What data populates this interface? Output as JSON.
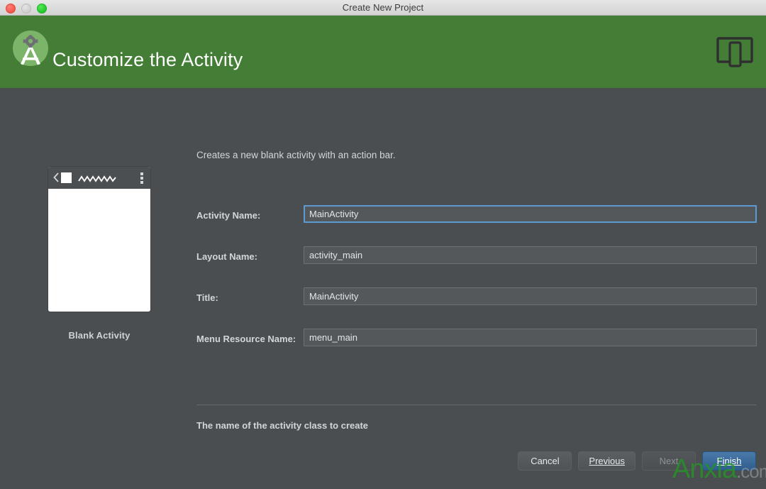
{
  "window": {
    "title": "Create New Project",
    "controls": [
      "close-button",
      "minimize-button",
      "zoom-button"
    ]
  },
  "header": {
    "title": "Customize the Activity",
    "logo_icon": "android-studio-logo-icon",
    "device_icon": "tablet-phone-device-icon",
    "background_color": "#437d36"
  },
  "preview": {
    "caption": "Blank Activity",
    "phone_bar": {
      "back_icon": "back-chevron-icon",
      "app_icon": "app-square-icon",
      "title_placeholder_icon": "zigzag-title-icon",
      "overflow_icon": "overflow-menu-icon"
    }
  },
  "main": {
    "description": "Creates a new blank activity with an action bar.",
    "fields": [
      {
        "label": "Activity Name:",
        "value": "MainActivity",
        "name": "activity-name",
        "focused": true
      },
      {
        "label": "Layout Name:",
        "value": "activity_main",
        "name": "layout-name",
        "focused": false
      },
      {
        "label": "Title:",
        "value": "MainActivity",
        "name": "title",
        "focused": false
      },
      {
        "label": "Menu Resource Name:",
        "value": "menu_main",
        "name": "menu-resource-name",
        "focused": false
      }
    ],
    "hint": "The name of the activity class to create"
  },
  "footer": {
    "buttons": [
      {
        "label": "Cancel",
        "name": "cancel-button",
        "state": "enabled",
        "mnemonic": ""
      },
      {
        "label": "Previous",
        "name": "previous-button",
        "state": "enabled",
        "mnemonic": "P"
      },
      {
        "label": "Next",
        "name": "next-button",
        "state": "disabled",
        "mnemonic": ""
      },
      {
        "label": "Finish",
        "name": "finish-button",
        "state": "default",
        "mnemonic": "F"
      }
    ]
  },
  "watermark": {
    "primary": "Anxia",
    "secondary": ".com"
  },
  "colors": {
    "header_green": "#437d36",
    "panel_gray": "#4b4e51",
    "field_bg": "#55585b",
    "focus_blue": "#5b9bd0",
    "default_button_blue": "#2f5d8e"
  }
}
